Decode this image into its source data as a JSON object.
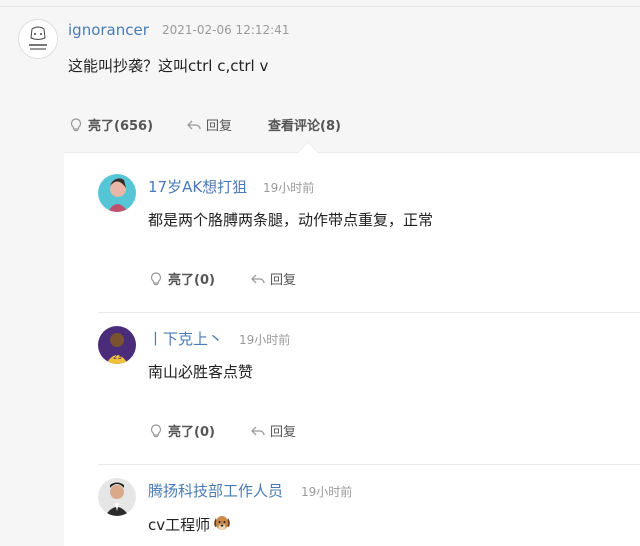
{
  "main_comment": {
    "username": "ignorancer",
    "timestamp": "2021-02-06 12:12:41",
    "text": "这能叫抄袭？这叫ctrl c,ctrl v",
    "actions": {
      "like_label": "亮了(656)",
      "reply_label": "回复",
      "view_comments_label": "查看评论(8)"
    }
  },
  "replies": [
    {
      "username": "17岁AK想打狙",
      "time": "19小时前",
      "text": "都是两个胳膊两条腿，动作带点重复，正常",
      "like_label": "亮了(0)",
      "reply_label": "回复"
    },
    {
      "username": "丨下克上丶",
      "time": "19小时前",
      "text": "南山必胜客点赞",
      "like_label": "亮了(0)",
      "reply_label": "回复"
    },
    {
      "username": "腾扬科技部工作人员",
      "time": "19小时前",
      "text": "cv工程师",
      "emoji": "dog-face-icon"
    }
  ],
  "colors": {
    "username": "#4a7bb7",
    "muted": "#9a9a9a",
    "background": "#f6f6f6",
    "panel": "#ffffff"
  }
}
